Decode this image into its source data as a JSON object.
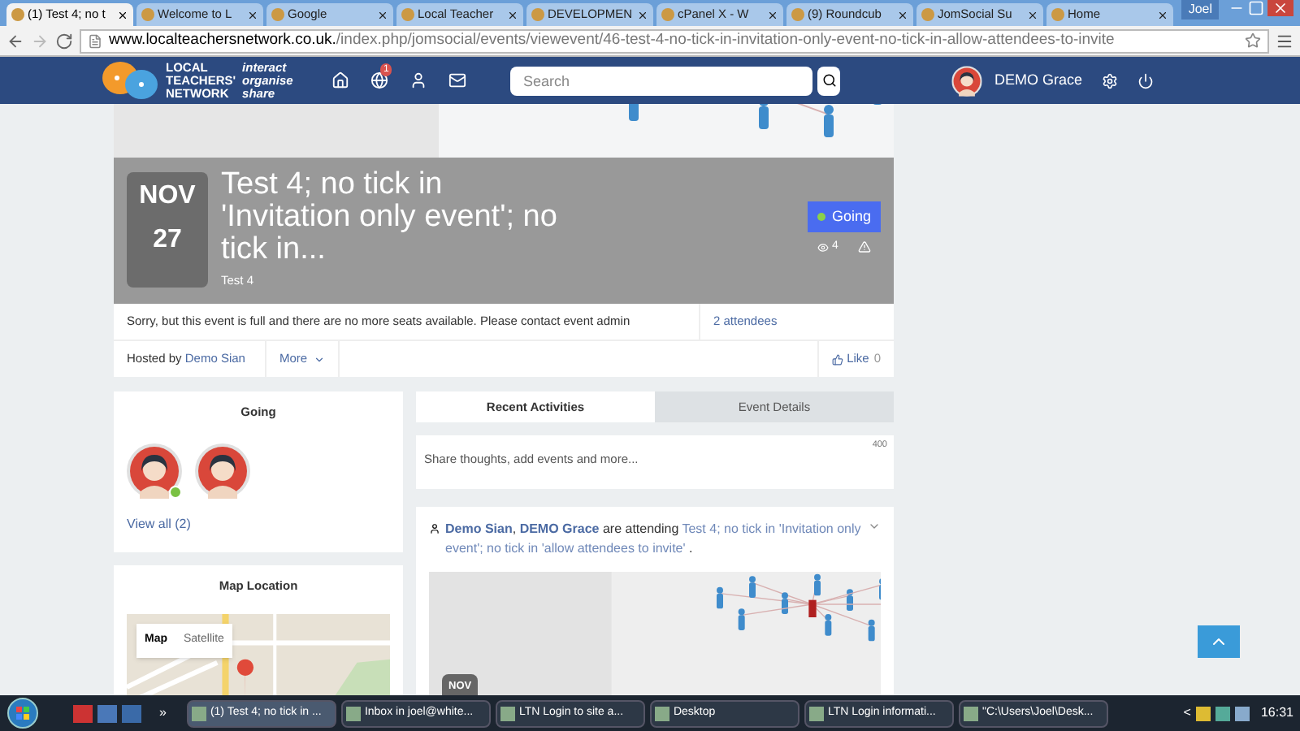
{
  "browser": {
    "tabs": [
      {
        "title": "(1) Test 4; no t",
        "selected": true
      },
      {
        "title": "Welcome to L",
        "selected": false
      },
      {
        "title": "Google",
        "selected": false
      },
      {
        "title": "Local Teacher",
        "selected": false
      },
      {
        "title": "DEVELOPMEN",
        "selected": false
      },
      {
        "title": "cPanel X - W",
        "selected": false
      },
      {
        "title": "(9) Roundcub",
        "selected": false
      },
      {
        "title": "JomSocial Su",
        "selected": false
      },
      {
        "title": "Home",
        "selected": false
      }
    ],
    "user": "Joel",
    "url_host": "www.localteachersnetwork.co.uk.",
    "url_path": "/index.php/jomsocial/events/viewevent/46-test-4-no-tick-in-invitation-only-event-no-tick-in-allow-attendees-to-invite"
  },
  "nav": {
    "logo_lines": [
      "LOCAL",
      "TEACHERS'",
      "NETWORK"
    ],
    "tagline": [
      "interact",
      "organise",
      "share"
    ],
    "notification_badge": "1",
    "search_placeholder": "Search",
    "user_name": "DEMO Grace"
  },
  "event": {
    "month": "NOV",
    "day": "27",
    "title": "Test 4; no tick in 'Invitation only event'; no tick in...",
    "subtitle": "Test 4",
    "rsvp": "Going",
    "views": "4",
    "notice": "Sorry, but this event is full and there are no more seats available. Please contact event admin",
    "attendees_link": "2 attendees",
    "hosted_by": "Hosted by",
    "host": "Demo Sian",
    "more": "More",
    "like": "Like",
    "like_count": "0"
  },
  "going": {
    "title": "Going",
    "members": [
      {
        "online": true
      },
      {
        "online": false
      }
    ],
    "view_all": "View all (2)"
  },
  "map": {
    "title": "Map Location",
    "buttons": [
      {
        "label": "Map",
        "selected": true
      },
      {
        "label": "Satellite",
        "selected": false
      }
    ]
  },
  "activity_tabs": [
    {
      "label": "Recent Activities",
      "selected": true
    },
    {
      "label": "Event Details",
      "selected": false
    }
  ],
  "share": {
    "placeholder": "Share thoughts, add events and more...",
    "limit": "400"
  },
  "activity": {
    "actor1": "Demo Sian",
    "separator": ",",
    "actor2": "DEMO Grace",
    "verb": "are attending",
    "event_link": "Test 4; no tick in 'Invitation only event'; no tick in 'allow attendees to invite'",
    "end": ".",
    "date_label": "NOV"
  },
  "taskbar": {
    "quick_more": "»",
    "tasks": [
      {
        "label": "(1) Test 4; no tick in ...",
        "selected": true
      },
      {
        "label": "Inbox in joel@white...",
        "selected": false
      },
      {
        "label": "LTN  Login to site a...",
        "selected": false
      },
      {
        "label": "Desktop",
        "selected": false
      },
      {
        "label": "LTN Login informati...",
        "selected": false
      },
      {
        "label": "\"C:\\Users\\Joel\\Desk...",
        "selected": false
      }
    ],
    "tray_arrow": "<",
    "time": "16:31"
  }
}
